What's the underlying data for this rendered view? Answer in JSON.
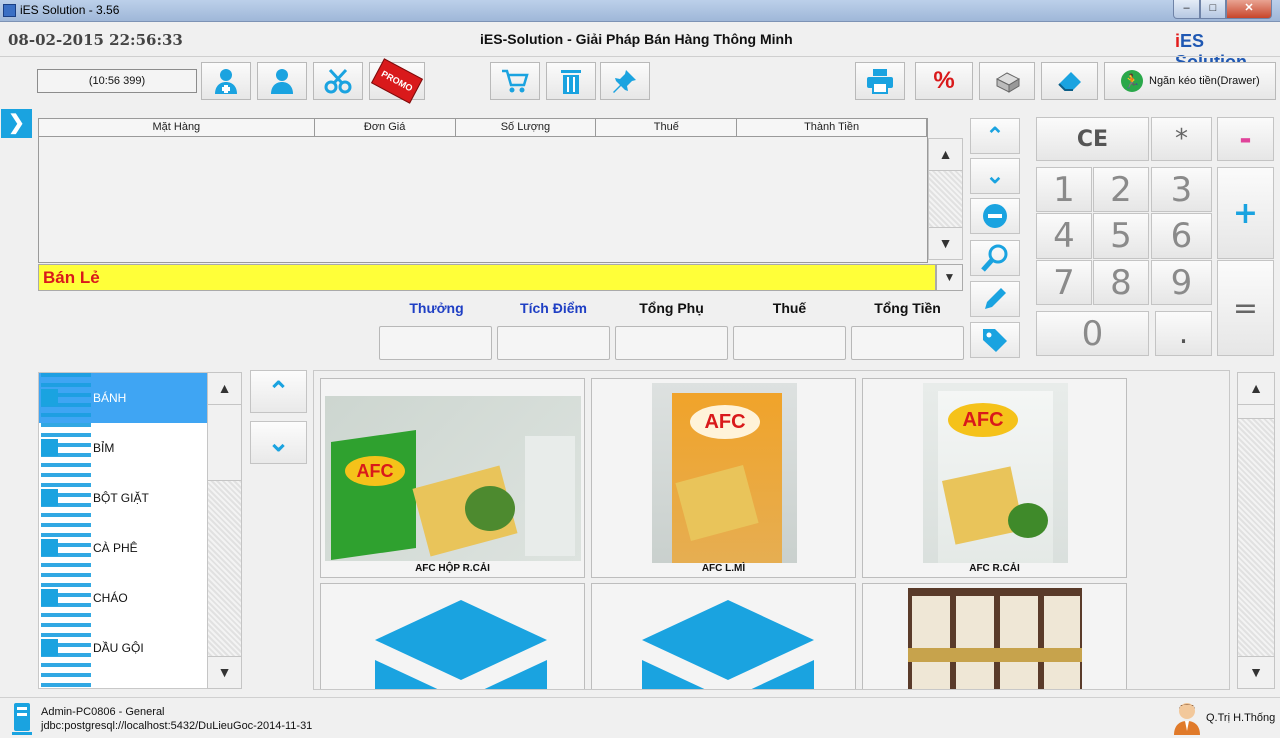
{
  "window": {
    "title": "iES Solution - 3.56",
    "min": "–",
    "max": "□",
    "close": "✕"
  },
  "header": {
    "datetime": "08-02-2015 22:56:33",
    "app_title": "iES-Solution - Giải Pháp Bán Hàng Thông Minh",
    "brand_i": "i",
    "brand_rest": "ES Solution"
  },
  "toolbar": {
    "timer": "(10:56 399)",
    "promo_label": "PROMO",
    "drawer_label": "Ngăn kéo tiền(Drawer)"
  },
  "grid": {
    "columns": [
      "Mặt Hàng",
      "Đơn Giá",
      "Số Lượng",
      "Thuế",
      "Thành Tiền"
    ],
    "rows": []
  },
  "price_type": "Bán Lẻ",
  "totals": {
    "labels": [
      "Thưởng",
      "Tích Điểm",
      "Tổng Phụ",
      "Thuế",
      "Tổng Tiền"
    ],
    "label_colors": [
      "#1f3fc4",
      "#1f3fc4",
      "#111111",
      "#111111",
      "#111111"
    ],
    "values": [
      "",
      "",
      "",
      "",
      ""
    ]
  },
  "keypad": {
    "ce": "CE",
    "star": "*",
    "minus": "-",
    "plus": "+",
    "equals": "=",
    "dot": ".",
    "digits": [
      "1",
      "2",
      "3",
      "4",
      "5",
      "6",
      "7",
      "8",
      "9",
      "0"
    ]
  },
  "categories": [
    {
      "label": "BÁNH",
      "selected": true
    },
    {
      "label": "BỈM"
    },
    {
      "label": "BỘT GIẶT"
    },
    {
      "label": "CÀ PHÊ"
    },
    {
      "label": "CHÁO"
    },
    {
      "label": "DẦU GỘI"
    }
  ],
  "products": [
    {
      "name": "AFC HỘP R.CẢI"
    },
    {
      "name": "AFC L.MÌ"
    },
    {
      "name": "AFC R.CẢI"
    },
    {
      "name": ""
    },
    {
      "name": ""
    },
    {
      "name": ""
    }
  ],
  "status": {
    "line1": "Admin-PC0806 - General",
    "line2": "jdbc:postgresql://localhost:5432/DuLieuGoc-2014-11-31",
    "user": "Q.Trị H.Thống"
  },
  "colors": {
    "accent": "#1aa3e0",
    "price_bar": "#ffff39",
    "price_text": "#d9191b",
    "brand": "#1f58b3"
  }
}
